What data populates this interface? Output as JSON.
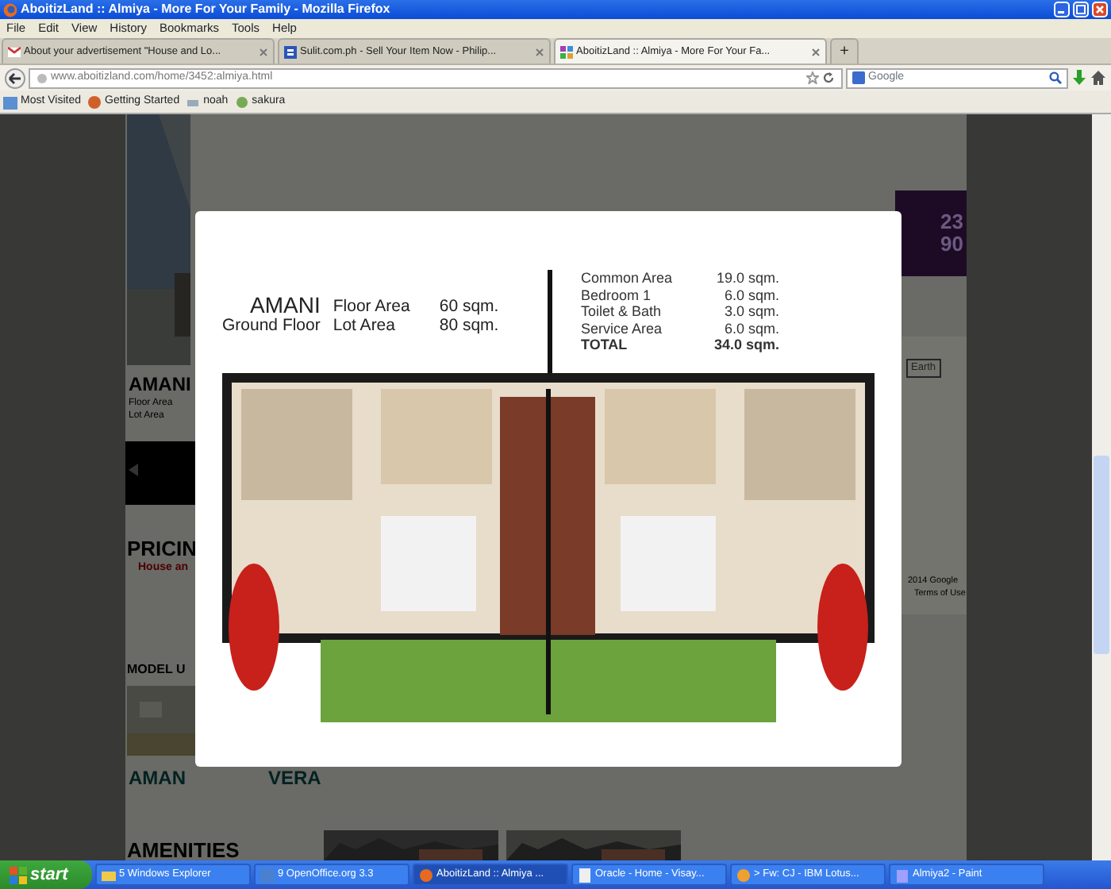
{
  "window": {
    "title": "AboitizLand :: Almiya - More For Your Family - Mozilla Firefox"
  },
  "menu": [
    "File",
    "Edit",
    "View",
    "History",
    "Bookmarks",
    "Tools",
    "Help"
  ],
  "tabs": [
    {
      "label": "About your advertisement \"House and Lo...",
      "selected": false
    },
    {
      "label": "Sulit.com.ph - Sell Your Item Now - Philip...",
      "selected": false
    },
    {
      "label": "AboitizLand :: Almiya - More For Your Fa...",
      "selected": true
    }
  ],
  "new_tab": "+",
  "address": {
    "url": "www.aboitizland.com/home/3452:almiya.html"
  },
  "search": {
    "placeholder": "Google"
  },
  "bookmarks": [
    {
      "label": "Most Visited"
    },
    {
      "label": "Getting Started"
    },
    {
      "label": "noah"
    },
    {
      "label": "sakura"
    }
  ],
  "page": {
    "model_name": "AMANI",
    "floor_area": "Floor Area",
    "lot_area": "Lot Area",
    "pricing": "PRICIN",
    "pricing_link": "House an",
    "model_units": "MODEL U",
    "model_1": "AMAN",
    "model_2": "VERA",
    "amenities": "AMENITIES",
    "promo_1": "23",
    "promo_2": "90",
    "map_button": "Earth",
    "map_copyright": "2014 Google",
    "map_terms": "Terms of Use"
  },
  "lightbox": {
    "model": "AMANI",
    "floor": "Ground Floor",
    "areas": [
      {
        "label": "Floor Area",
        "value": "60 sqm."
      },
      {
        "label": "Lot Area",
        "value": "80 sqm."
      }
    ],
    "rooms": [
      {
        "label": "Common Area",
        "value": "19.0 sqm.",
        "total": false
      },
      {
        "label": "Bedroom 1",
        "value": "6.0 sqm.",
        "total": false
      },
      {
        "label": "Toilet & Bath",
        "value": "3.0 sqm.",
        "total": false
      },
      {
        "label": "Service Area",
        "value": "6.0 sqm.",
        "total": false
      },
      {
        "label": "TOTAL",
        "value": "34.0 sqm.",
        "total": true
      }
    ]
  },
  "taskbar": {
    "start": "start",
    "items": [
      {
        "label": "5 Windows Explorer",
        "selected": false
      },
      {
        "label": "9 OpenOffice.org 3.3",
        "selected": false
      },
      {
        "label": "AboitizLand :: Almiya ...",
        "selected": true
      },
      {
        "label": "Oracle - Home - Visay...",
        "selected": false
      },
      {
        "label": "> Fw: CJ - IBM Lotus...",
        "selected": false
      },
      {
        "label": "Almiya2 - Paint",
        "selected": false
      }
    ]
  }
}
